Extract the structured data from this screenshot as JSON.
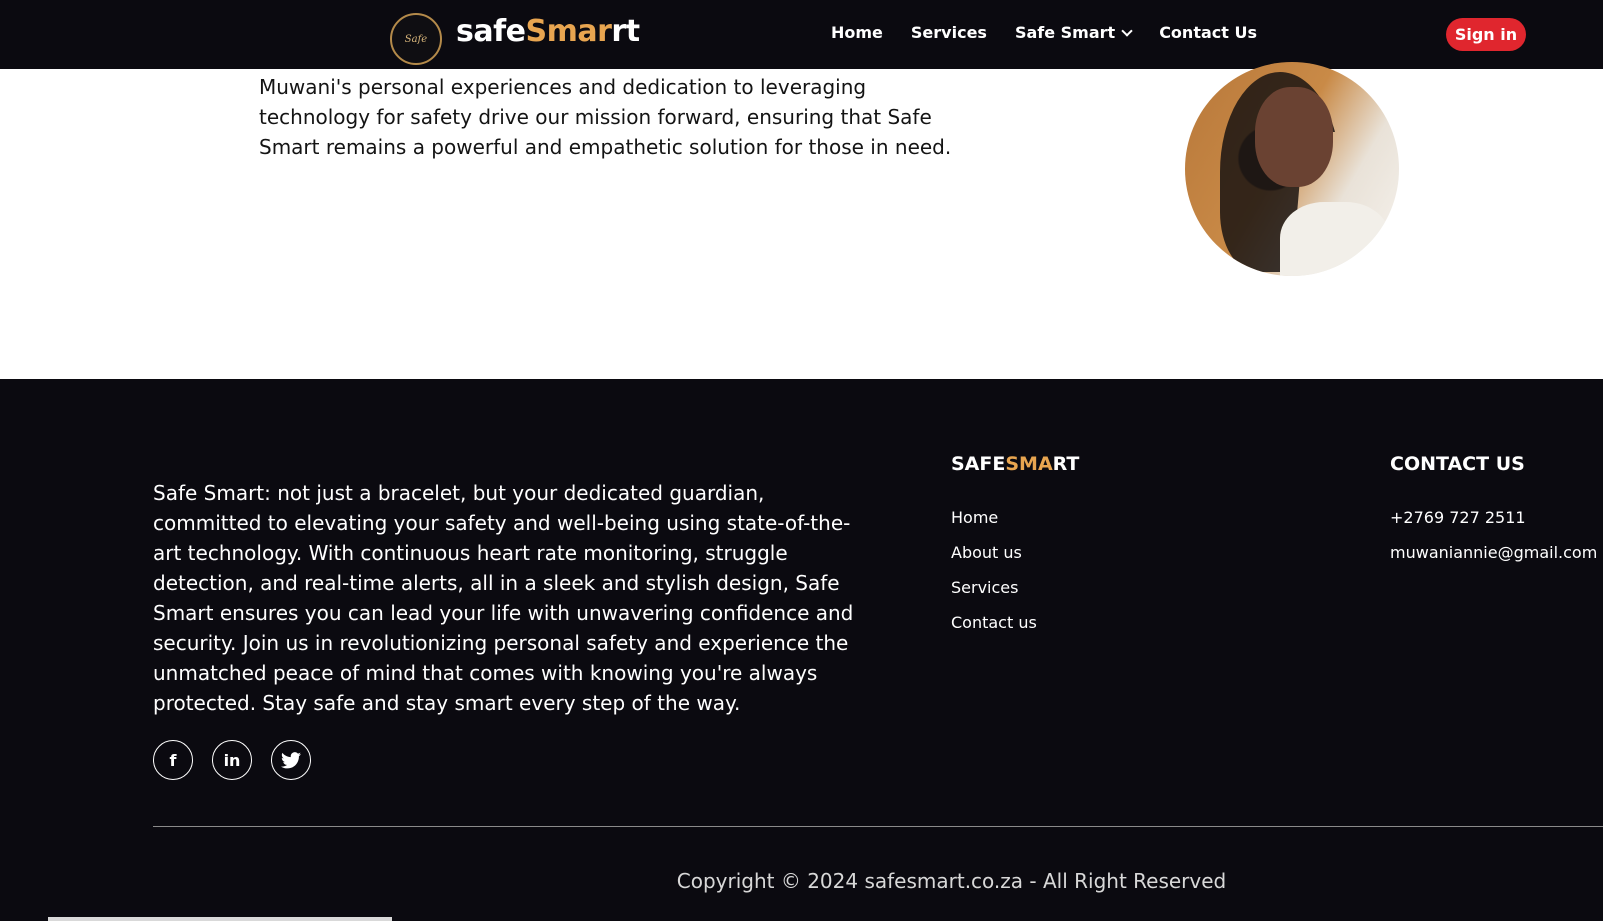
{
  "nav": {
    "logo_text": "Safe",
    "brand_plain": "safe",
    "brand_highlight": "Smar",
    "brand_end": "rt",
    "links": [
      "Home",
      "Services",
      "Safe Smart",
      "Contact Us"
    ],
    "signin_label": "Sign in"
  },
  "about": {
    "text": "Muwani's personal experiences and dedication to leveraging technology for safety drive our mission forward, ensuring that Safe Smart remains a powerful and empathetic solution for those in need."
  },
  "footer": {
    "description": "Safe Smart: not just a bracelet, but your dedicated guardian, committed to elevating your safety and well-being using state-of-the-art technology. With continuous heart rate monitoring, struggle detection, and real-time alerts, all in a sleek and stylish design, Safe Smart ensures you can lead your life with unwavering confidence and security. Join us in revolutionizing personal safety and experience the unmatched peace of mind that comes with knowing you're always protected. Stay safe and stay smart every step of the way.",
    "socials": [
      "f",
      "in",
      "t"
    ],
    "links_title_plain": "SAFE",
    "links_title_highlight": "SMA",
    "links_title_end": "RT",
    "links": [
      "Home",
      "About us",
      "Services",
      "Contact us"
    ],
    "contact_title": "CONTACT US",
    "phone": "+2769 727 2511",
    "email": "muwaniannie@gmail.com",
    "copyright": "Copyright © 2024 safesmart.co.za - All Right Reserved"
  },
  "colors": {
    "accent": "#e8a550",
    "signin_bg": "#e0262e",
    "dark_bg": "#0b0a10"
  }
}
